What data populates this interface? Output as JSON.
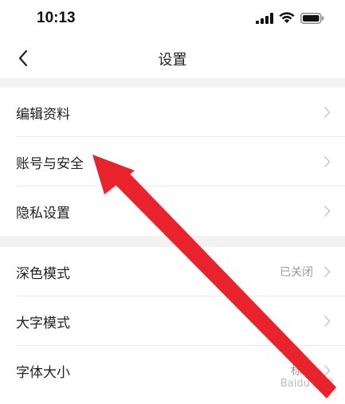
{
  "status_bar": {
    "time": "10:13",
    "icons": [
      "signal-icon",
      "wifi-icon",
      "battery-icon"
    ]
  },
  "nav": {
    "title": "设置",
    "back_icon": "chevron-left-icon"
  },
  "sections": [
    {
      "items": [
        {
          "label": "编辑资料",
          "value": ""
        },
        {
          "label": "账号与安全",
          "value": ""
        },
        {
          "label": "隐私设置",
          "value": ""
        }
      ]
    },
    {
      "items": [
        {
          "label": "深色模式",
          "value": "已关闭"
        },
        {
          "label": "大字模式",
          "value": ""
        },
        {
          "label": "字体大小",
          "value": "标准"
        }
      ]
    }
  ],
  "annotation": {
    "type": "arrow",
    "color": "#e8232b",
    "points_to": "账号与安全"
  },
  "watermark": "Baidu 经验",
  "colors": {
    "background": "#ffffff",
    "section_gap": "#f2f2f2",
    "divider": "#ececec",
    "secondary_text": "#999999",
    "chevron": "#c8c8c8"
  }
}
